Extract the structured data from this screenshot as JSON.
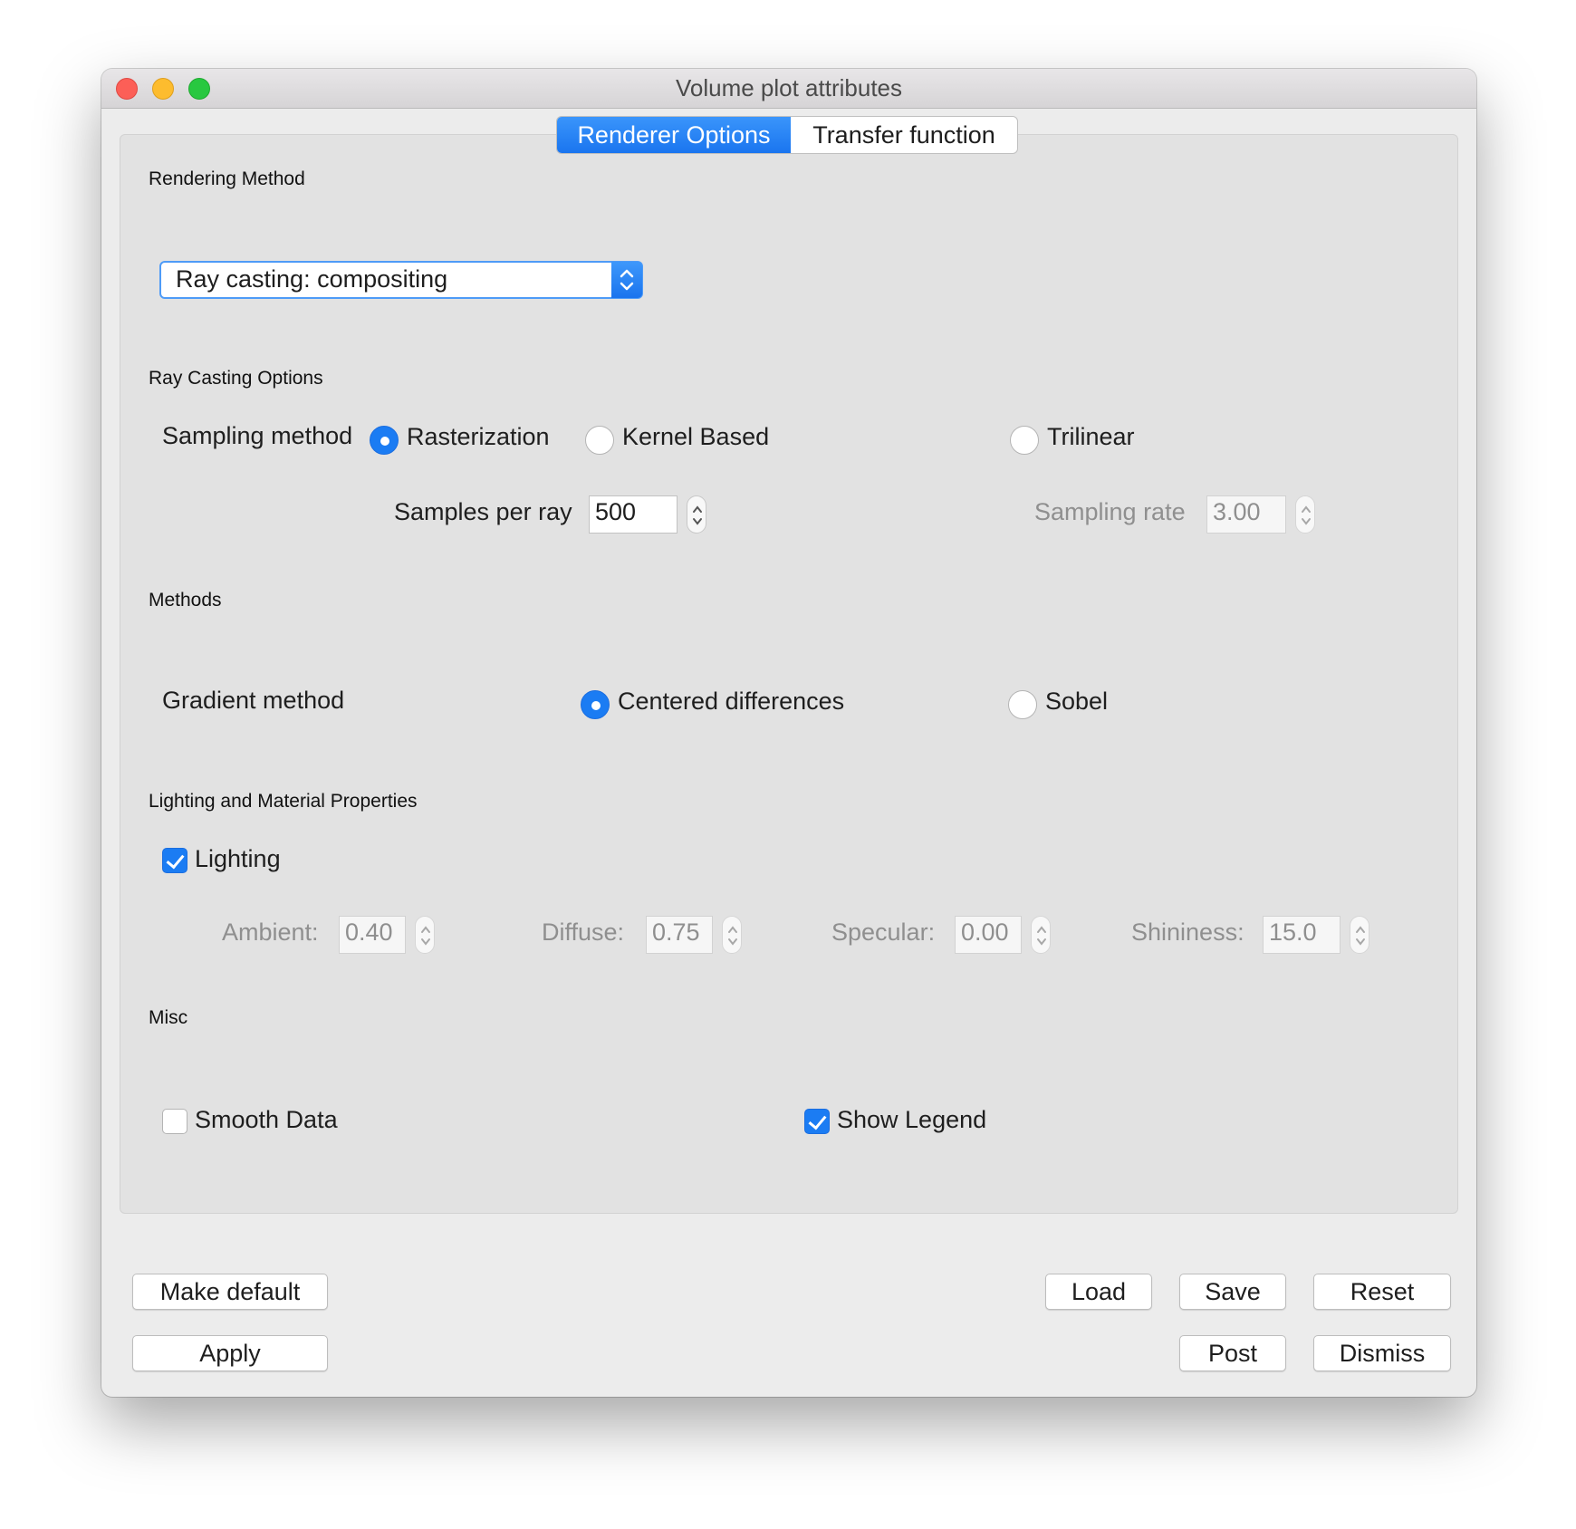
{
  "window": {
    "title": "Volume plot attributes"
  },
  "tabs": [
    {
      "label": "Renderer Options",
      "active": true
    },
    {
      "label": "Transfer function",
      "active": false
    }
  ],
  "rendering_method": {
    "group_title": "Rendering Method",
    "selected": "Ray casting: compositing"
  },
  "ray_casting": {
    "group_title": "Ray Casting Options",
    "sampling_method_label": "Sampling method",
    "options": [
      "Rasterization",
      "Kernel Based",
      "Trilinear"
    ],
    "selected_option": "Rasterization",
    "samples_per_ray_label": "Samples per ray",
    "samples_per_ray_value": "500",
    "sampling_rate_label": "Sampling rate",
    "sampling_rate_value": "3.00"
  },
  "methods": {
    "group_title": "Methods",
    "gradient_label": "Gradient method",
    "options": [
      "Centered differences",
      "Sobel"
    ],
    "selected_option": "Centered differences"
  },
  "lighting": {
    "group_title": "Lighting and Material Properties",
    "lighting_label": "Lighting",
    "lighting_checked": true,
    "ambient_label": "Ambient:",
    "ambient_value": "0.40",
    "diffuse_label": "Diffuse:",
    "diffuse_value": "0.75",
    "specular_label": "Specular:",
    "specular_value": "0.00",
    "shininess_label": "Shininess:",
    "shininess_value": "15.0"
  },
  "misc": {
    "group_title": "Misc",
    "smooth_label": "Smooth Data",
    "smooth_checked": false,
    "legend_label": "Show Legend",
    "legend_checked": true
  },
  "buttons": {
    "make_default": "Make default",
    "apply": "Apply",
    "load": "Load",
    "save": "Save",
    "reset": "Reset",
    "post": "Post",
    "dismiss": "Dismiss"
  },
  "colors": {
    "accent": "#1b7cf3",
    "window_bg": "#ececec",
    "panel_bg": "#e2e2e2"
  }
}
